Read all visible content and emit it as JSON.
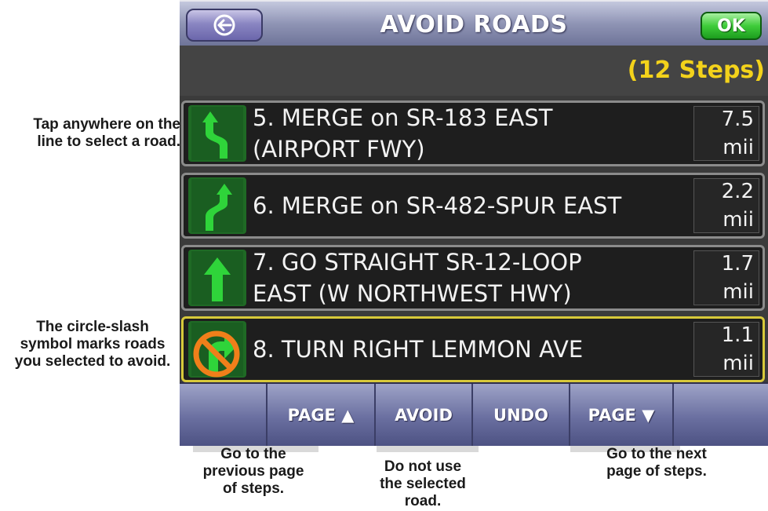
{
  "header": {
    "title": "AVOID ROADS",
    "ok_label": "OK",
    "steps_count": "(12 Steps)"
  },
  "steps": [
    {
      "text": [
        "5. MERGE on SR-183 EAST",
        "(AIRPORT FWY)"
      ],
      "distance": "7.5",
      "unit": "mii",
      "icon": "merge-left-arrow-icon",
      "avoided": false
    },
    {
      "text": [
        "6. MERGE on SR-482-SPUR EAST"
      ],
      "distance": "2.2",
      "unit": "mii",
      "icon": "merge-right-arrow-icon",
      "avoided": false
    },
    {
      "text": [
        "7. GO STRAIGHT SR-12-LOOP",
        "EAST (W NORTHWEST HWY)"
      ],
      "distance": "1.7",
      "unit": "mii",
      "icon": "straight-arrow-icon",
      "avoided": false
    },
    {
      "text": [
        "8. TURN RIGHT LEMMON AVE"
      ],
      "distance": "1.1",
      "unit": "mii",
      "icon": "turn-right-arrow-icon",
      "avoided": true
    }
  ],
  "toolbar": {
    "page_up": "PAGE ▲",
    "avoid": "AVOID",
    "undo": "UNDO",
    "page_down": "PAGE ▼"
  },
  "callouts": {
    "tap_line": [
      "Tap anywhere on the",
      "line to select a road."
    ],
    "circle_slash": [
      "The circle-slash",
      "symbol marks roads",
      "you selected to avoid."
    ],
    "prev_page": [
      "Go to the",
      "previous page",
      "of steps."
    ],
    "avoid_road": [
      "Do not use",
      "the selected",
      "road."
    ],
    "next_page": [
      "Go to the next",
      "page of steps."
    ]
  },
  "colors": {
    "steps_count": "#f3d21b",
    "ok_button": "#3fcc3a",
    "selected_border": "#d8c93a",
    "avoid_symbol": "#f07f1a"
  }
}
